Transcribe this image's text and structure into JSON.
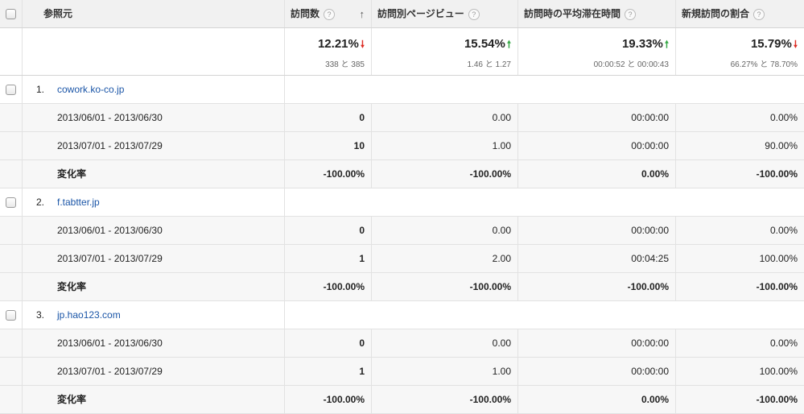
{
  "columns": {
    "source": "参照元",
    "visits": "訪問数",
    "pages_per_visit": "訪問別ページビュー",
    "avg_duration": "訪問時の平均滞在時間",
    "new_visit_pct": "新規訪問の割合"
  },
  "help_glyph": "?",
  "sort_glyph": "↑",
  "arrow_down": "🠗",
  "arrow_up": "🠕",
  "summary": {
    "visits": {
      "pct": "12.21%",
      "sub": "338 と 385",
      "trend": "down"
    },
    "pages_per_visit": {
      "pct": "15.54%",
      "sub": "1.46 と 1.27",
      "trend": "up"
    },
    "avg_duration": {
      "pct": "19.33%",
      "sub": "00:00:52 と 00:00:43",
      "trend": "up"
    },
    "new_visit_pct": {
      "pct": "15.79%",
      "sub": "66.27% と 78.70%",
      "trend": "down"
    }
  },
  "groups": [
    {
      "index": "1.",
      "source": "cowork.ko-co.jp",
      "rows": [
        {
          "label": "2013/06/01 - 2013/06/30",
          "visits": "0",
          "ppv": "0.00",
          "dur": "00:00:00",
          "newp": "0.00%"
        },
        {
          "label": "2013/07/01 - 2013/07/29",
          "visits": "10",
          "ppv": "1.00",
          "dur": "00:00:00",
          "newp": "90.00%"
        },
        {
          "label": "変化率",
          "visits": "-100.00%",
          "ppv": "-100.00%",
          "dur": "0.00%",
          "newp": "-100.00%"
        }
      ]
    },
    {
      "index": "2.",
      "source": "f.tabtter.jp",
      "rows": [
        {
          "label": "2013/06/01 - 2013/06/30",
          "visits": "0",
          "ppv": "0.00",
          "dur": "00:00:00",
          "newp": "0.00%"
        },
        {
          "label": "2013/07/01 - 2013/07/29",
          "visits": "1",
          "ppv": "2.00",
          "dur": "00:04:25",
          "newp": "100.00%"
        },
        {
          "label": "変化率",
          "visits": "-100.00%",
          "ppv": "-100.00%",
          "dur": "-100.00%",
          "newp": "-100.00%"
        }
      ]
    },
    {
      "index": "3.",
      "source": "jp.hao123.com",
      "rows": [
        {
          "label": "2013/06/01 - 2013/06/30",
          "visits": "0",
          "ppv": "0.00",
          "dur": "00:00:00",
          "newp": "0.00%"
        },
        {
          "label": "2013/07/01 - 2013/07/29",
          "visits": "1",
          "ppv": "1.00",
          "dur": "00:00:00",
          "newp": "100.00%"
        },
        {
          "label": "変化率",
          "visits": "-100.00%",
          "ppv": "-100.00%",
          "dur": "0.00%",
          "newp": "-100.00%"
        }
      ]
    }
  ]
}
